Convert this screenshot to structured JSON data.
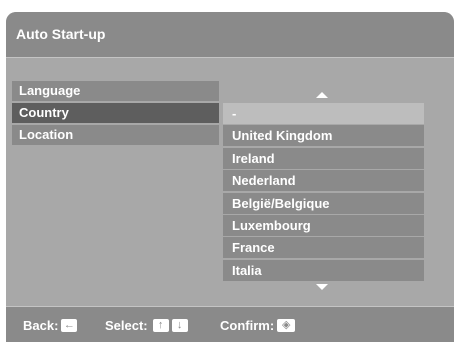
{
  "title": "Auto Start-up",
  "left_menu": [
    {
      "label": "Language",
      "selected": false
    },
    {
      "label": "Country",
      "selected": true
    },
    {
      "label": "Location",
      "selected": false
    }
  ],
  "country_list": [
    {
      "label": "-",
      "highlighted": true
    },
    {
      "label": "United Kingdom"
    },
    {
      "label": "Ireland"
    },
    {
      "label": "Nederland"
    },
    {
      "label": "België/Belgique"
    },
    {
      "label": "Luxembourg"
    },
    {
      "label": "France"
    },
    {
      "label": "Italia"
    }
  ],
  "scroll_up_icon": "triangle-up",
  "scroll_down_icon": "triangle-down",
  "footer": {
    "back_label": "Back:",
    "back_icon": "left-arrow-key",
    "select_label": "Select:",
    "select_icons": [
      "up-arrow-key",
      "down-arrow-key"
    ],
    "confirm_label": "Confirm:",
    "confirm_icon": "center-confirm-key"
  },
  "colors": {
    "background": "#a8a8a8",
    "bar": "#8a8a8a",
    "selected": "#5e5e5e",
    "highlight": "#bdbdbd",
    "text": "#ffffff"
  }
}
